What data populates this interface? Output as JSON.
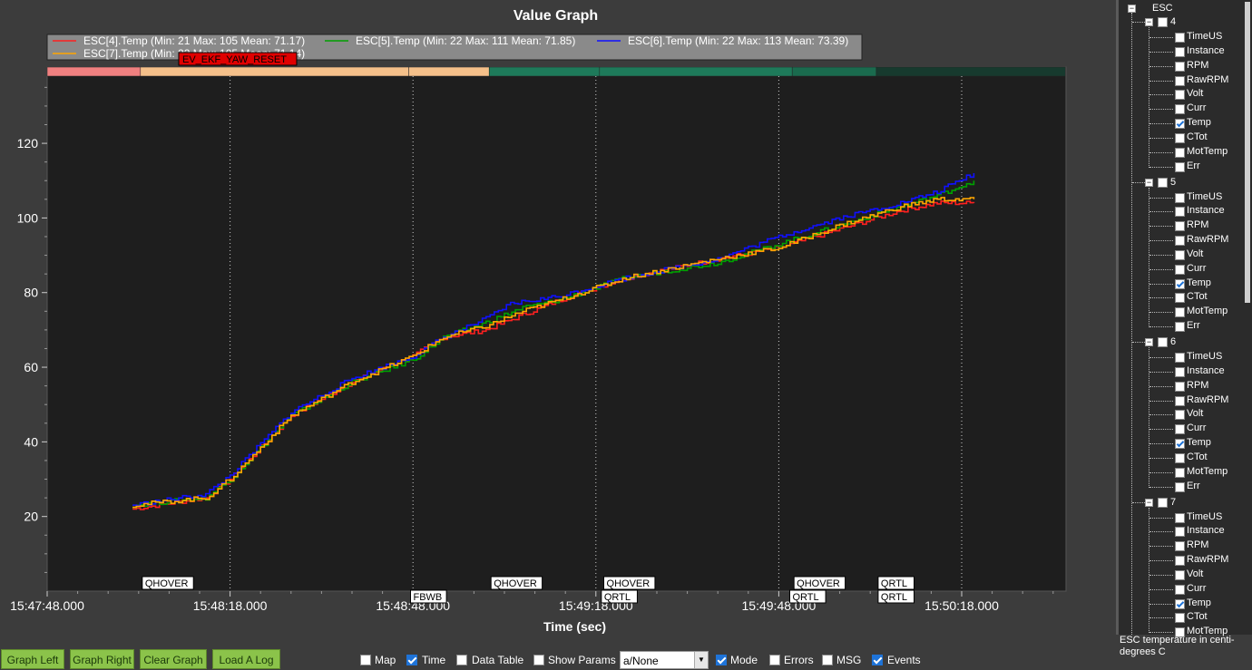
{
  "chart_data": {
    "type": "line",
    "title": "Value Graph",
    "xlabel": "Time (sec)",
    "ylabel": "",
    "x_unit": "seconds since 15:47:48",
    "xlim": [
      0,
      158
    ],
    "ylim": [
      0,
      138
    ],
    "x_ticks": [
      {
        "t": 0,
        "label": "15:47:48.000"
      },
      {
        "t": 30,
        "label": "15:48:18.000"
      },
      {
        "t": 60,
        "label": "15:48:48.000"
      },
      {
        "t": 90,
        "label": "15:49:18.000"
      },
      {
        "t": 120,
        "label": "15:49:48.000"
      },
      {
        "t": 150,
        "label": "15:50:18.000"
      }
    ],
    "y_ticks": [
      20,
      40,
      60,
      80,
      100,
      120
    ],
    "legend_position": "top",
    "series": [
      {
        "name": "ESC[4].Temp",
        "legend": "ESC[4].Temp  (Min: 21 Max: 105 Mean: 71.17)",
        "color": "#ff2020",
        "points": [
          [
            14,
            22
          ],
          [
            26,
            25
          ],
          [
            30,
            30
          ],
          [
            40,
            47
          ],
          [
            50,
            56
          ],
          [
            60,
            63
          ],
          [
            65,
            68
          ],
          [
            72,
            70
          ],
          [
            78,
            74
          ],
          [
            84,
            78
          ],
          [
            95,
            84
          ],
          [
            110,
            89
          ],
          [
            120,
            92
          ],
          [
            130,
            97
          ],
          [
            140,
            102
          ],
          [
            146,
            104
          ],
          [
            152,
            104
          ]
        ]
      },
      {
        "name": "ESC[5].Temp",
        "legend": "ESC[5].Temp  (Min: 22 Max: 111 Mean: 71.85)",
        "color": "#00a000",
        "points": [
          [
            14,
            23
          ],
          [
            26,
            25
          ],
          [
            30,
            30
          ],
          [
            40,
            47
          ],
          [
            50,
            56
          ],
          [
            60,
            62
          ],
          [
            65,
            68
          ],
          [
            72,
            72
          ],
          [
            78,
            76
          ],
          [
            84,
            78
          ],
          [
            95,
            84
          ],
          [
            110,
            88
          ],
          [
            120,
            93
          ],
          [
            130,
            98
          ],
          [
            140,
            103
          ],
          [
            146,
            106
          ],
          [
            152,
            110
          ]
        ]
      },
      {
        "name": "ESC[6].Temp",
        "legend": "ESC[6].Temp  (Min: 22 Max: 113 Mean: 73.39)",
        "color": "#1010ff",
        "points": [
          [
            14,
            23
          ],
          [
            26,
            26
          ],
          [
            30,
            31
          ],
          [
            40,
            48
          ],
          [
            50,
            57
          ],
          [
            60,
            63
          ],
          [
            65,
            68
          ],
          [
            72,
            73
          ],
          [
            76,
            77
          ],
          [
            84,
            79
          ],
          [
            95,
            84
          ],
          [
            110,
            89
          ],
          [
            120,
            95
          ],
          [
            130,
            100
          ],
          [
            140,
            104
          ],
          [
            146,
            107
          ],
          [
            152,
            112
          ]
        ]
      },
      {
        "name": "ESC[7].Temp",
        "legend": "ESC[7].Temp  (Min: 22 Max: 105 Mean: 71.14)",
        "color": "#ffa500",
        "points": [
          [
            14,
            23
          ],
          [
            26,
            25
          ],
          [
            30,
            30
          ],
          [
            40,
            47
          ],
          [
            50,
            56
          ],
          [
            60,
            63
          ],
          [
            65,
            68
          ],
          [
            72,
            71
          ],
          [
            78,
            75
          ],
          [
            84,
            78
          ],
          [
            95,
            84
          ],
          [
            110,
            89
          ],
          [
            120,
            92
          ],
          [
            130,
            98
          ],
          [
            140,
            103
          ],
          [
            146,
            105
          ],
          [
            152,
            105
          ]
        ]
      }
    ],
    "event_flag": "EV_EKF_YAW_RESET",
    "mode_bands": [
      {
        "t0": 0,
        "t1": 15.3,
        "color": "#f08080"
      },
      {
        "t0": 15.3,
        "t1": 59.3,
        "color": "#f5c08a"
      },
      {
        "t0": 59.3,
        "t1": 72.5,
        "color": "#f5c08a"
      },
      {
        "t0": 72.5,
        "t1": 90.6,
        "color": "#1e7a5a"
      },
      {
        "t0": 90.6,
        "t1": 122.2,
        "color": "#1e7a5a"
      },
      {
        "t0": 122.2,
        "t1": 136.0,
        "color": "#1a6b4e"
      },
      {
        "t0": 136.0,
        "t1": 167.0,
        "color": "#173a2e"
      }
    ],
    "mode_labels": [
      {
        "t": 15.3,
        "row": 0,
        "label": "QHOVER"
      },
      {
        "t": 59.3,
        "row": 1,
        "label": "FBWB"
      },
      {
        "t": 72.5,
        "row": 0,
        "label": "QHOVER"
      },
      {
        "t": 91.0,
        "row": 0,
        "label": "QHOVER"
      },
      {
        "t": 90.6,
        "row": 1,
        "label": "QRTL"
      },
      {
        "t": 122.2,
        "row": 0,
        "label": "QHOVER"
      },
      {
        "t": 121.5,
        "row": 1,
        "label": "QRTL"
      },
      {
        "t": 136.0,
        "row": 0,
        "label": "QRTL"
      },
      {
        "t": 136.0,
        "row": 1,
        "label": "QRTL"
      }
    ],
    "grid": true
  },
  "buttons": {
    "graph_left": "Graph Left",
    "graph_right": "Graph Right",
    "clear_graph": "Clear Graph",
    "load_log": "Load A Log"
  },
  "options": {
    "map": "Map",
    "time": "Time",
    "data_table": "Data Table",
    "show_params": "Show Params",
    "select_value": "a/None",
    "mode": "Mode",
    "errors": "Errors",
    "msg": "MSG",
    "events": "Events"
  },
  "tree": {
    "root": "ESC",
    "groups": [
      {
        "name": "4",
        "items": [
          "TimeUS",
          "Instance",
          "RPM",
          "RawRPM",
          "Volt",
          "Curr",
          "Temp",
          "CTot",
          "MotTemp",
          "Err"
        ],
        "checked": "Temp"
      },
      {
        "name": "5",
        "items": [
          "TimeUS",
          "Instance",
          "RPM",
          "RawRPM",
          "Volt",
          "Curr",
          "Temp",
          "CTot",
          "MotTemp",
          "Err"
        ],
        "checked": "Temp"
      },
      {
        "name": "6",
        "items": [
          "TimeUS",
          "Instance",
          "RPM",
          "RawRPM",
          "Volt",
          "Curr",
          "Temp",
          "CTot",
          "MotTemp",
          "Err"
        ],
        "checked": "Temp"
      },
      {
        "name": "7",
        "items": [
          "TimeUS",
          "Instance",
          "RPM",
          "RawRPM",
          "Volt",
          "Curr",
          "Temp",
          "CTot",
          "MotTemp"
        ],
        "checked": "Temp"
      }
    ]
  },
  "status_text": "ESC temperature in centi-degrees C"
}
